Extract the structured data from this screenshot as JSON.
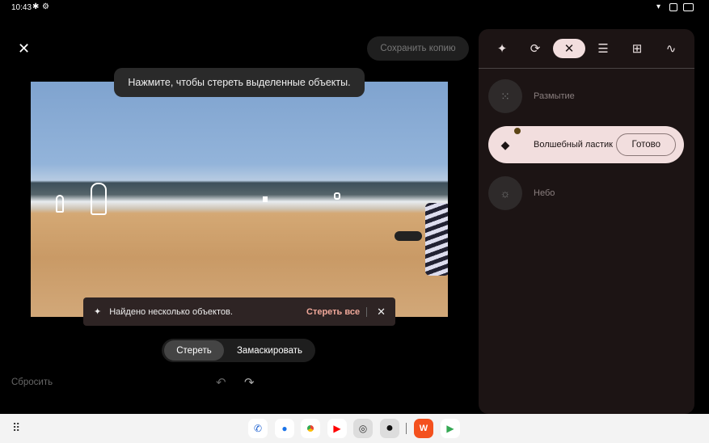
{
  "status": {
    "time": "10:43",
    "left_icons": [
      "bluetooth-icon",
      "settings-icon"
    ],
    "right_icons": [
      "wifi-icon",
      "sim-icon",
      "battery-icon"
    ]
  },
  "header": {
    "close_icon": "close-icon",
    "save_copy": "Сохранить копию"
  },
  "tooltip": "Нажмите, чтобы стереть выделенные объекты.",
  "snackbar": {
    "icon": "sparkle-icon",
    "message": "Найдено несколько объектов.",
    "action": "Стереть все",
    "close_icon": "close-icon"
  },
  "segmented": {
    "options": [
      "Стереть",
      "Замаскировать"
    ],
    "selected": "Стереть"
  },
  "footer": {
    "reset": "Сбросить",
    "undo_icon": "undo-icon",
    "redo_icon": "redo-icon"
  },
  "panel": {
    "tabs": [
      {
        "icon": "sparkle-icon"
      },
      {
        "icon": "crop-rotate-icon"
      },
      {
        "icon": "tools-icon",
        "active": true
      },
      {
        "icon": "sliders-icon"
      },
      {
        "icon": "add-frame-icon"
      },
      {
        "icon": "markup-icon"
      }
    ],
    "tools": [
      {
        "label": "Размытие",
        "icon": "blur-icon"
      },
      {
        "label": "Волшебный ластик",
        "icon": "eraser-icon",
        "active": true,
        "done": "Готово"
      },
      {
        "label": "Небо",
        "icon": "sky-icon"
      }
    ]
  },
  "dock": {
    "apps": [
      "phone",
      "messages",
      "chrome",
      "youtube",
      "settings",
      "camera",
      "wps-office",
      "play-store"
    ],
    "apps_icon": "apps-grid-icon"
  },
  "colors": {
    "accent_pill": "#f2dede",
    "action": "#f0a89a",
    "panel_bg": "#1c1414"
  }
}
